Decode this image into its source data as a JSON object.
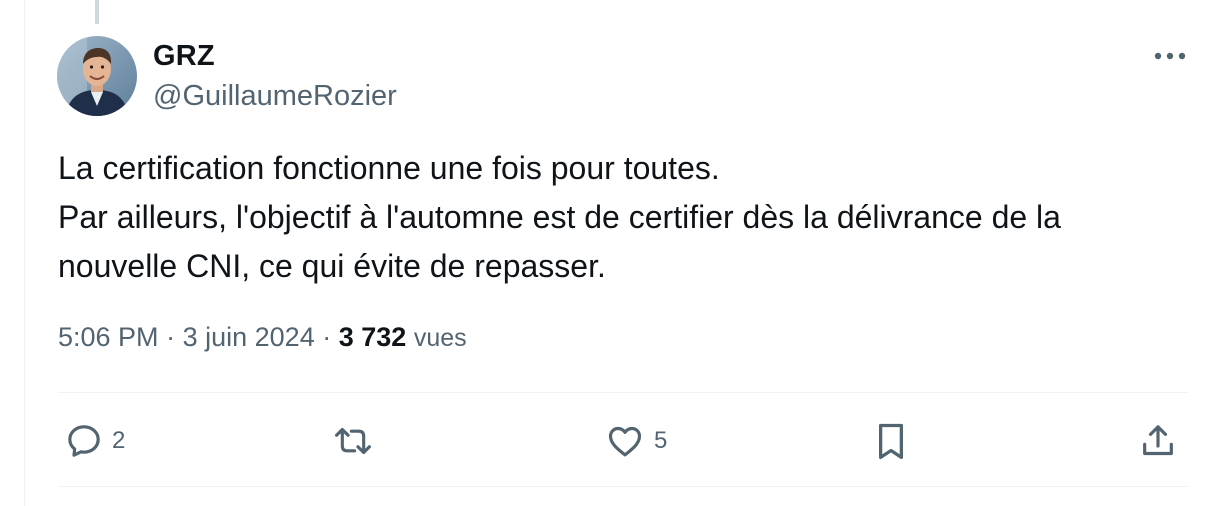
{
  "tweet": {
    "author": {
      "display_name": "GRZ",
      "handle": "@GuillaumeRozier"
    },
    "text_lines": [
      "La certification fonctionne une fois pour toutes.",
      "Par ailleurs, l'objectif à l'automne est de certifier dès la délivrance de la",
      "nouvelle CNI, ce qui évite de repasser."
    ],
    "time": "5:06 PM",
    "separator": "·",
    "date": "3 juin 2024",
    "views_count": "3 732",
    "views_label": "vues"
  },
  "actions": {
    "reply_count": "2",
    "like_count": "5"
  },
  "icons": {
    "more": "more-horizontal-icon",
    "reply": "reply-icon",
    "retweet": "retweet-icon",
    "like": "heart-icon",
    "bookmark": "bookmark-icon",
    "share": "share-icon"
  },
  "colors": {
    "text_primary": "#0f1419",
    "text_secondary": "#536471",
    "divider": "#eff3f4",
    "thread_line": "#cfd9de"
  }
}
